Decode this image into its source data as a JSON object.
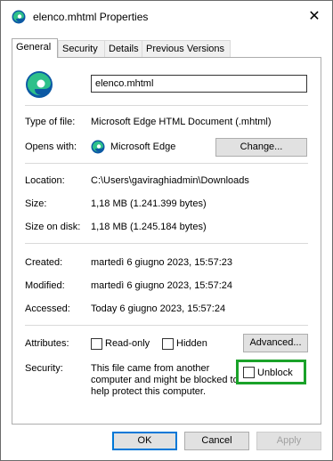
{
  "window": {
    "title": "elenco.mhtml Properties",
    "close_label": "✕"
  },
  "tabs": [
    "General",
    "Security",
    "Details",
    "Previous Versions"
  ],
  "general": {
    "file_name": "elenco.mhtml",
    "type_label": "Type of file:",
    "type_value": "Microsoft Edge HTML Document (.mhtml)",
    "opens_label": "Opens with:",
    "opens_value": "Microsoft Edge",
    "change_button": "Change...",
    "location_label": "Location:",
    "location_value": "C:\\Users\\gaviraghiadmin\\Downloads",
    "size_label": "Size:",
    "size_value": "1,18 MB (1.241.399 bytes)",
    "size_disk_label": "Size on disk:",
    "size_disk_value": "1,18 MB (1.245.184 bytes)",
    "created_label": "Created:",
    "created_value": "martedì 6 giugno 2023, 15:57:23",
    "modified_label": "Modified:",
    "modified_value": "martedì 6 giugno 2023, 15:57:24",
    "accessed_label": "Accessed:",
    "accessed_value": "Today 6 giugno 2023, 15:57:24",
    "attributes_label": "Attributes:",
    "readonly_label": "Read-only",
    "hidden_label": "Hidden",
    "advanced_button": "Advanced...",
    "security_label": "Security:",
    "security_text_1": "This file came from another",
    "security_text_2": "computer and might be blocked to",
    "security_text_3": "help protect this computer.",
    "unblock_label": "Unblock"
  },
  "footer": {
    "ok": "OK",
    "cancel": "Cancel",
    "apply": "Apply"
  },
  "colors": {
    "highlight": "#1aa229",
    "accent": "#0078d7"
  },
  "icons": {
    "app": "edge-icon",
    "file": "edge-file-icon",
    "opens_with": "edge-icon"
  }
}
